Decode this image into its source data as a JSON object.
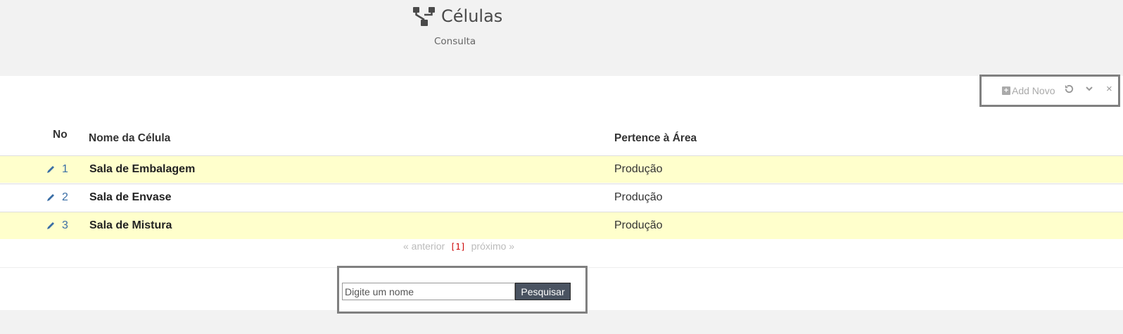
{
  "header": {
    "title": "Células",
    "subtitle": "Consulta",
    "icon": "sitemap-icon"
  },
  "toolbox": {
    "add_label": "Add Novo",
    "add_icon": "plus-square-icon",
    "refresh_icon": "refresh-icon",
    "collapse_icon": "chevron-down-icon",
    "close_icon": "close-icon"
  },
  "table": {
    "columns": [
      "No",
      "Nome da Célula",
      "Pertence à Área"
    ],
    "rows": [
      {
        "num": "1",
        "name": "Sala de Embalagem",
        "area": "Produção"
      },
      {
        "num": "2",
        "name": "Sala de Envase",
        "area": "Produção"
      },
      {
        "num": "3",
        "name": "Sala de Mistura",
        "area": "Produção"
      }
    ]
  },
  "pager": {
    "prev": "« anterior",
    "current": "[1]",
    "next": "próximo »"
  },
  "search": {
    "placeholder": "Digite um nome",
    "button": "Pesquisar"
  },
  "colors": {
    "row_highlight": "#ffffcc",
    "button_bg": "#4a5361",
    "link": "#3a6ea5"
  }
}
